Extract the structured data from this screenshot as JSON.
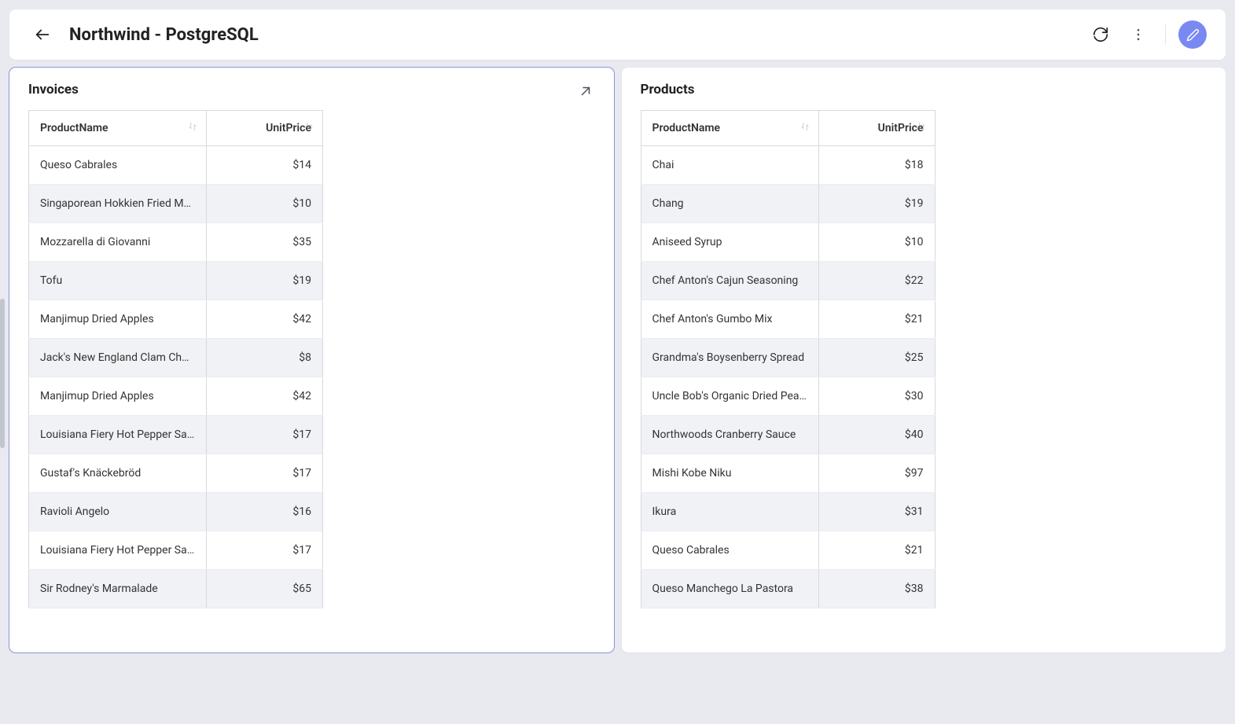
{
  "header": {
    "title": "Northwind - PostgreSQL"
  },
  "panels": {
    "invoices": {
      "title": "Invoices",
      "columns": [
        "ProductName",
        "UnitPrice"
      ],
      "rows": [
        {
          "name": "Queso Cabrales",
          "price": "$14"
        },
        {
          "name": "Singaporean Hokkien Fried Mee",
          "price": "$10"
        },
        {
          "name": "Mozzarella di Giovanni",
          "price": "$35"
        },
        {
          "name": "Tofu",
          "price": "$19"
        },
        {
          "name": "Manjimup Dried Apples",
          "price": "$42"
        },
        {
          "name": "Jack's New England Clam Chowder",
          "price": "$8"
        },
        {
          "name": "Manjimup Dried Apples",
          "price": "$42"
        },
        {
          "name": "Louisiana Fiery Hot Pepper Sauce",
          "price": "$17"
        },
        {
          "name": "Gustaf's Knäckebröd",
          "price": "$17"
        },
        {
          "name": "Ravioli Angelo",
          "price": "$16"
        },
        {
          "name": "Louisiana Fiery Hot Pepper Sauce",
          "price": "$17"
        },
        {
          "name": "Sir Rodney's Marmalade",
          "price": "$65"
        }
      ]
    },
    "products": {
      "title": "Products",
      "columns": [
        "ProductName",
        "UnitPrice"
      ],
      "rows": [
        {
          "name": "Chai",
          "price": "$18"
        },
        {
          "name": "Chang",
          "price": "$19"
        },
        {
          "name": "Aniseed Syrup",
          "price": "$10"
        },
        {
          "name": "Chef Anton's Cajun Seasoning",
          "price": "$22"
        },
        {
          "name": "Chef Anton's Gumbo Mix",
          "price": "$21"
        },
        {
          "name": "Grandma's Boysenberry Spread",
          "price": "$25"
        },
        {
          "name": "Uncle Bob's Organic Dried Pears",
          "price": "$30"
        },
        {
          "name": "Northwoods Cranberry Sauce",
          "price": "$40"
        },
        {
          "name": "Mishi Kobe Niku",
          "price": "$97"
        },
        {
          "name": "Ikura",
          "price": "$31"
        },
        {
          "name": "Queso Cabrales",
          "price": "$21"
        },
        {
          "name": "Queso Manchego La Pastora",
          "price": "$38"
        }
      ]
    }
  }
}
